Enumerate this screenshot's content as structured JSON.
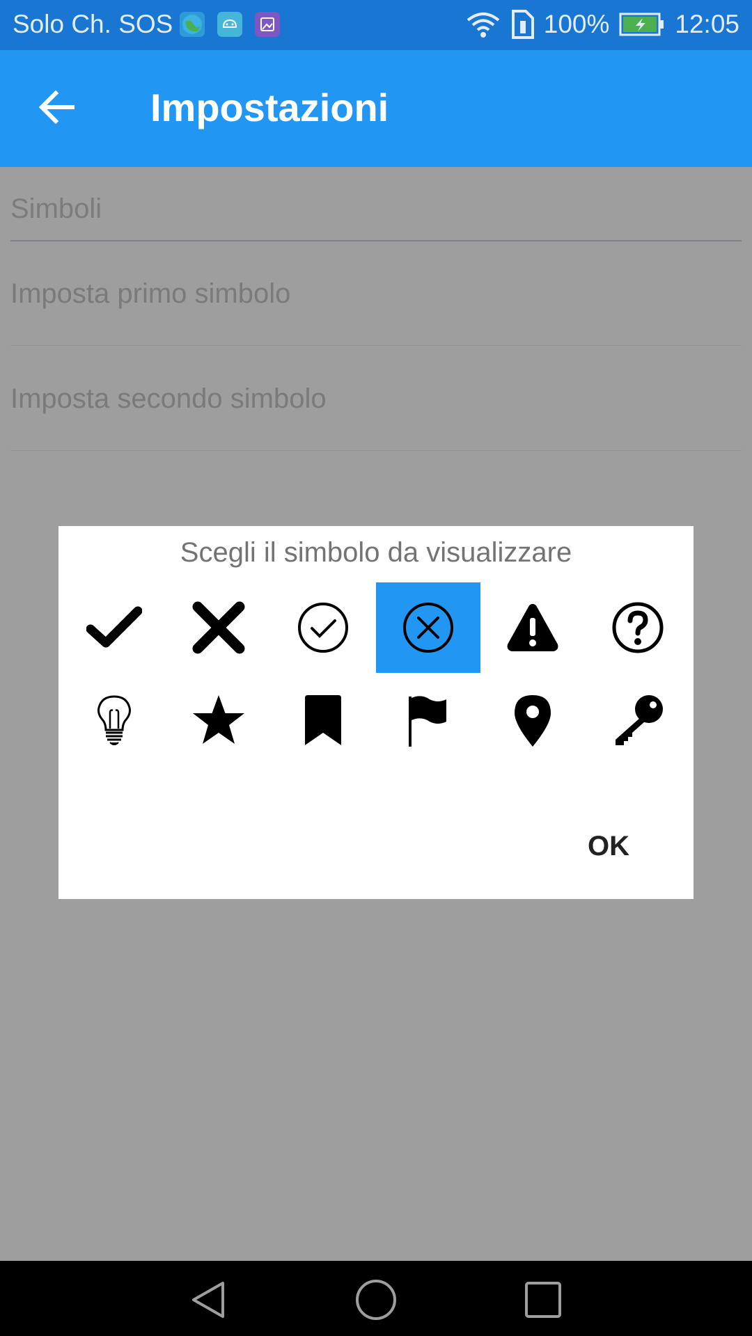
{
  "status_bar": {
    "carrier": "Solo Ch. SOS",
    "notification_icons": [
      "globe-app-icon",
      "android-icon",
      "gallery-icon"
    ],
    "battery": "100%",
    "time": "12:05"
  },
  "app_bar": {
    "title": "Impostazioni",
    "back_icon": "arrow-back-icon"
  },
  "settings": {
    "category": "Simboli",
    "items": [
      {
        "label": "Imposta primo simbolo"
      },
      {
        "label": "Imposta secondo simbolo"
      }
    ]
  },
  "dialog": {
    "title": "Scegli il simbolo da visualizzare",
    "symbols": [
      {
        "icon": "checkmark-icon"
      },
      {
        "icon": "cross-icon"
      },
      {
        "icon": "check-circle-icon"
      },
      {
        "icon": "cancel-circle-icon",
        "selected": true
      },
      {
        "icon": "warning-icon"
      },
      {
        "icon": "help-circle-icon"
      },
      {
        "icon": "lightbulb-icon"
      },
      {
        "icon": "star-icon"
      },
      {
        "icon": "bookmark-icon"
      },
      {
        "icon": "flag-icon"
      },
      {
        "icon": "location-pin-icon"
      },
      {
        "icon": "key-icon"
      }
    ],
    "ok_label": "OK"
  },
  "colors": {
    "status_bar": "#1976d2",
    "app_bar": "#2196f3",
    "selected": "#2196f3",
    "scrim": "#9e9e9e"
  }
}
